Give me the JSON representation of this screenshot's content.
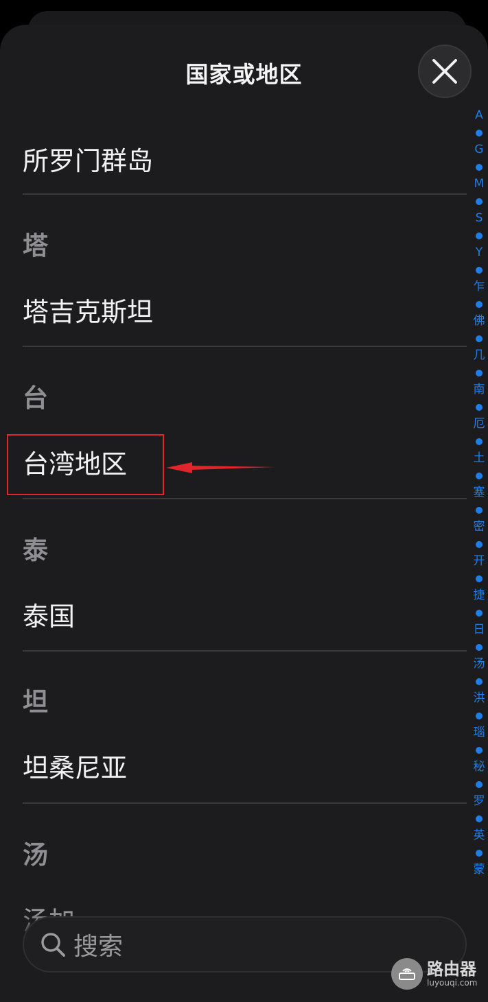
{
  "header": {
    "title": "国家或地区",
    "close_icon": "close-icon"
  },
  "list": {
    "rows": [
      {
        "type": "item",
        "label": "所罗门群岛"
      },
      {
        "type": "header",
        "label": "塔"
      },
      {
        "type": "item",
        "label": "塔吉克斯坦"
      },
      {
        "type": "header",
        "label": "台"
      },
      {
        "type": "item",
        "label": "台湾地区",
        "highlighted": true
      },
      {
        "type": "header",
        "label": "泰"
      },
      {
        "type": "item",
        "label": "泰国"
      },
      {
        "type": "header",
        "label": "坦"
      },
      {
        "type": "item",
        "label": "坦桑尼亚"
      },
      {
        "type": "header",
        "label": "汤"
      },
      {
        "type": "item",
        "label": "汤加"
      }
    ]
  },
  "index_bar": {
    "letters": [
      "A",
      "G",
      "M",
      "S",
      "Y",
      "乍",
      "佛",
      "几",
      "南",
      "厄",
      "土",
      "塞",
      "密",
      "开",
      "捷",
      "日",
      "汤",
      "洪",
      "瑙",
      "秘",
      "罗",
      "英",
      "蒙"
    ],
    "color": "#1f7fe8"
  },
  "annotation": {
    "highlight_color": "#e0252c"
  },
  "search": {
    "placeholder": "搜索",
    "icon": "search-icon"
  },
  "watermark": {
    "title": "路由器",
    "subtitle": "luyouqi.com"
  }
}
